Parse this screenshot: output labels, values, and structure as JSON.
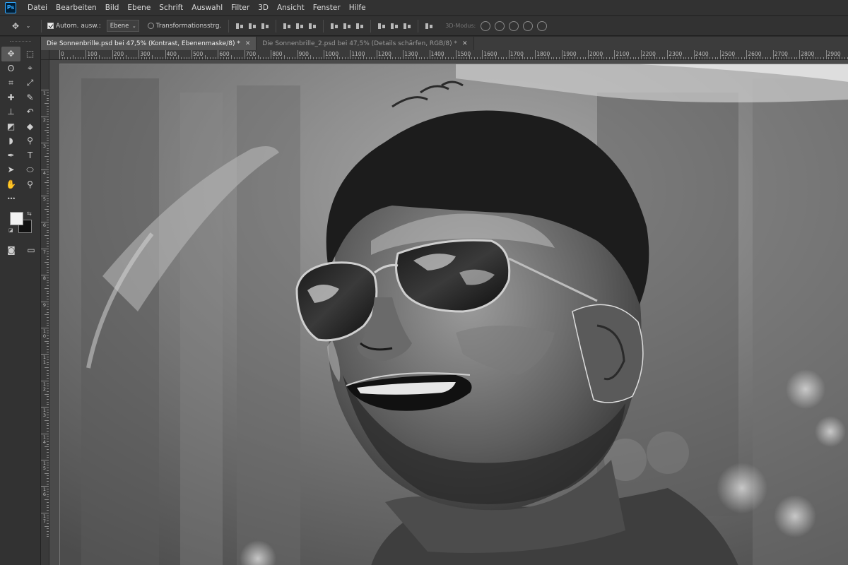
{
  "app": {
    "logo": "Ps"
  },
  "menu": [
    "Datei",
    "Bearbeiten",
    "Bild",
    "Ebene",
    "Schrift",
    "Auswahl",
    "Filter",
    "3D",
    "Ansicht",
    "Fenster",
    "Hilfe"
  ],
  "options": {
    "auto_select_label": "Autom. ausw.:",
    "auto_select_checked": true,
    "target_value": "Ebene",
    "transform_label": "Transformationsstrg.",
    "mode_3d_label": "3D-Modus:"
  },
  "tabs": [
    {
      "label": "Die Sonnenbrille.psd bei 47,5% (Kontrast, Ebenenmaske/8) *",
      "active": true
    },
    {
      "label": "Die Sonnenbrille_2.psd bei 47,5% (Details schärfen, RGB/8) *",
      "active": false
    }
  ],
  "ruler_h": [
    "0",
    "100",
    "200",
    "300",
    "400",
    "500",
    "600",
    "700",
    "800",
    "900",
    "1000",
    "1100",
    "1200",
    "1300",
    "1400",
    "1500",
    "1600",
    "1700",
    "1800",
    "1900",
    "2000",
    "2100",
    "2200",
    "2300",
    "2400",
    "2500",
    "2600",
    "2700",
    "2800",
    "2900"
  ],
  "ruler_v": [
    "1",
    "2",
    "3",
    "4",
    "5",
    "6",
    "7",
    "8",
    "9",
    "10",
    "11",
    "12",
    "13",
    "14",
    "15",
    "16",
    "17"
  ],
  "colors": {
    "foreground": "#f2f2f2",
    "background": "#111111",
    "accent": "#31a8ff"
  },
  "toolbox": {
    "tools": [
      {
        "name": "move-tool",
        "icon": "move-icon",
        "glyph": "✥"
      },
      {
        "name": "marquee-tool",
        "icon": "marquee-icon",
        "glyph": "⬚"
      },
      {
        "name": "lasso-tool",
        "icon": "lasso-icon",
        "glyph": "ʘ"
      },
      {
        "name": "quick-select-tool",
        "icon": "quick-select-icon",
        "glyph": "⌖"
      },
      {
        "name": "crop-tool",
        "icon": "crop-icon",
        "glyph": "⌗"
      },
      {
        "name": "eyedropper-tool",
        "icon": "eyedropper-icon",
        "glyph": "⤢"
      },
      {
        "name": "healing-tool",
        "icon": "bandage-icon",
        "glyph": "✚"
      },
      {
        "name": "brush-tool",
        "icon": "brush-icon",
        "glyph": "✎"
      },
      {
        "name": "stamp-tool",
        "icon": "stamp-icon",
        "glyph": "⊥"
      },
      {
        "name": "history-brush-tool",
        "icon": "history-brush-icon",
        "glyph": "↶"
      },
      {
        "name": "eraser-tool",
        "icon": "eraser-icon",
        "glyph": "◩"
      },
      {
        "name": "gradient-tool",
        "icon": "paint-bucket-icon",
        "glyph": "◆"
      },
      {
        "name": "blur-tool",
        "icon": "blur-icon",
        "glyph": "◗"
      },
      {
        "name": "dodge-tool",
        "icon": "dodge-icon",
        "glyph": "⚲"
      },
      {
        "name": "pen-tool",
        "icon": "pen-icon",
        "glyph": "✒"
      },
      {
        "name": "type-tool",
        "icon": "type-icon",
        "glyph": "T"
      },
      {
        "name": "path-select-tool",
        "icon": "arrow-icon",
        "glyph": "➤"
      },
      {
        "name": "shape-tool",
        "icon": "ellipse-icon",
        "glyph": "⬭"
      },
      {
        "name": "hand-tool",
        "icon": "hand-icon",
        "glyph": "✋"
      },
      {
        "name": "zoom-tool",
        "icon": "zoom-icon",
        "glyph": "⚲"
      },
      {
        "name": "more-tools",
        "icon": "ellipsis-icon",
        "glyph": "•••"
      },
      {
        "name": "edit-toolbar",
        "icon": "edit-toolbar-icon",
        "glyph": ""
      }
    ]
  }
}
